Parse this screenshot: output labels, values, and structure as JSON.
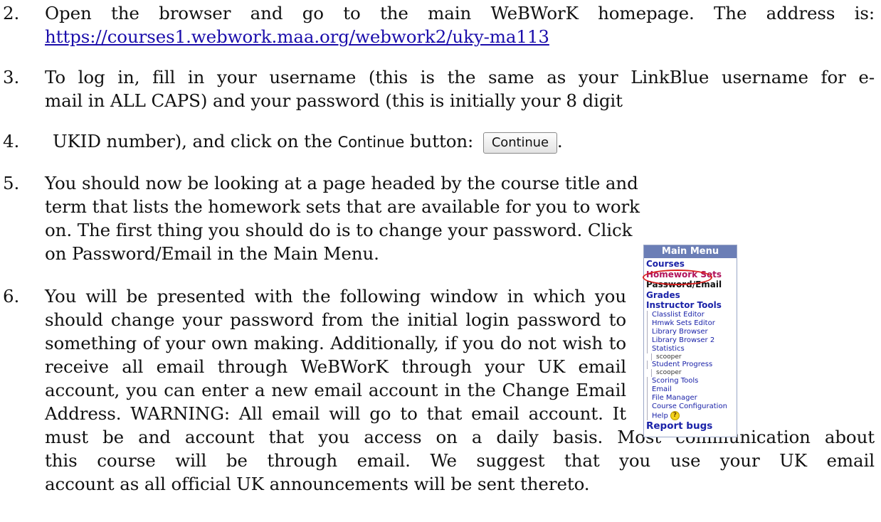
{
  "steps": [
    {
      "num": "2.",
      "line1": "Open the browser and go to the main WeBWorK homepage. The address is:",
      "link": "https://courses1.webwork.maa.org/webwork2/uky-ma113"
    },
    {
      "num": "3.",
      "line1": "To log in, fill in your username (this is the same as your LinkBlue username for e-",
      "line2": "mail in ALL CAPS) and your password (this is initially your 8 digit"
    },
    {
      "num": "4.",
      "text_before": "UKID number), and click on the ",
      "continue_word": "Continue",
      "text_middle": " button: ",
      "button_label": "Continue",
      "text_after": "."
    },
    {
      "num": "5.",
      "lines": [
        "You should now be looking at a page headed by the course title and",
        "term that lists the homework sets that are available for you to work",
        "on.  The first thing you should do is to change your password.  Click",
        "on Password/Email in the Main Menu."
      ]
    },
    {
      "num": "6.",
      "lines": [
        "You will be presented with the following window in which you",
        "should change your password from the initial login password to",
        "something of your own making.  Additionally, if you do not wish to",
        "receive all email through WeBWorK through your UK email",
        "account, you can enter a new email account in the Change Email",
        "Address.  WARNING:  All email will go to that email account.  It",
        "must be and account that you access on a daily basis.  Most communication about",
        "this course will be through email.   We suggest that you use your UK email",
        "account as all official UK announcements will be sent thereto."
      ]
    }
  ],
  "main_menu": {
    "title": "Main Menu",
    "courses": "Courses",
    "homework_sets": "Homework Sets",
    "password_email": "Password/Email",
    "grades": "Grades",
    "instructor_tools": "Instructor Tools",
    "classlist_editor": "Classlist Editor",
    "hmwk_sets_editor": "Hmwk Sets Editor",
    "library_browser": "Library Browser",
    "library_browser_2": "Library Browser 2",
    "statistics": "Statistics",
    "statistics_user": "scooper",
    "student_progress": "Student Progress",
    "student_progress_user": "scooper",
    "scoring_tools": "Scoring Tools",
    "email": "Email",
    "file_manager": "File Manager",
    "course_configuration": "Course Configuration",
    "help": "Help",
    "report_bugs": "Report bugs",
    "help_icon": "help-question-icon",
    "highlight_color": "#d81d1d",
    "header_color": "#6b7eb6"
  }
}
